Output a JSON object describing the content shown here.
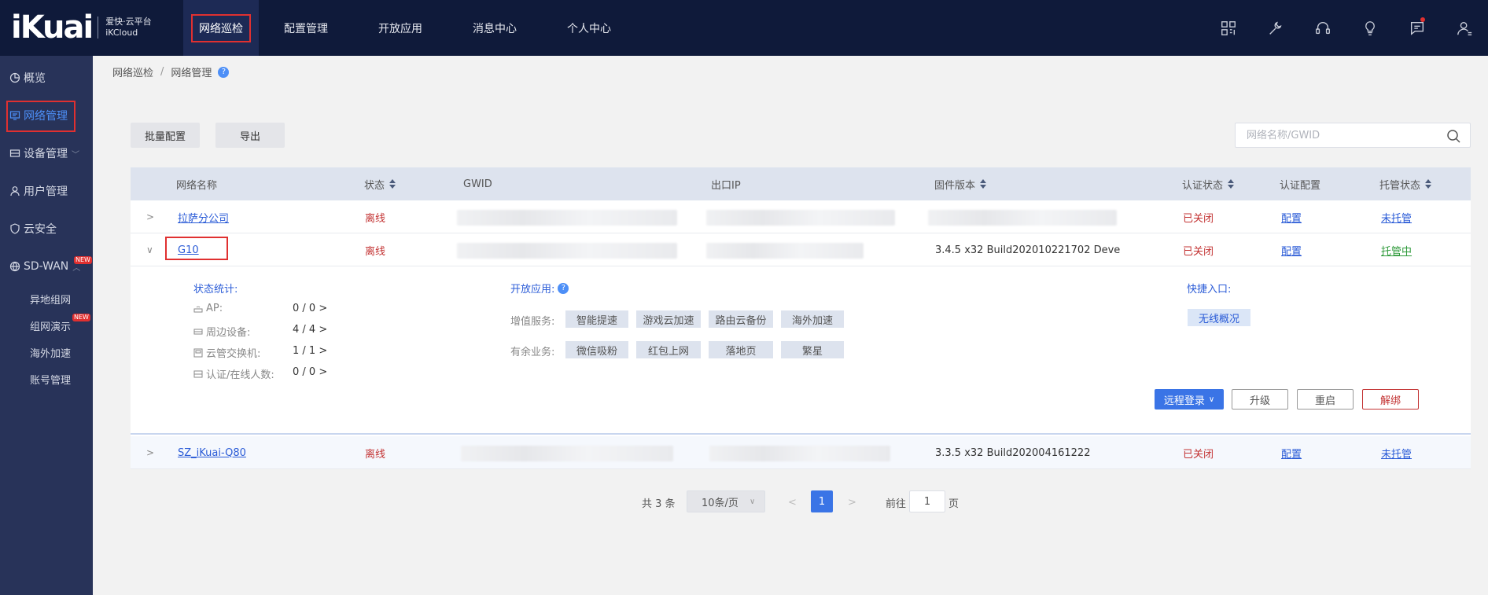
{
  "brand": {
    "name": "iKuai",
    "cn": "爱快·云平台",
    "en": "iKCloud"
  },
  "topnav": [
    "网络巡检",
    "配置管理",
    "开放应用",
    "消息中心",
    "个人中心"
  ],
  "top_icons": [
    "grid-icon",
    "tool-icon",
    "headset-icon",
    "bulb-icon",
    "message-icon",
    "user-icon"
  ],
  "sidebar": {
    "items": [
      "概览",
      "网络管理",
      "设备管理",
      "用户管理",
      "云安全",
      "SD-WAN"
    ],
    "sdwan_sub": [
      "异地组网",
      "组网演示",
      "海外加速",
      "账号管理"
    ],
    "new_badge": "NEW"
  },
  "breadcrumb": [
    "网络巡检",
    "网络管理"
  ],
  "toolbar": {
    "batch": "批量配置",
    "export": "导出"
  },
  "search": {
    "placeholder": "网络名称/GWID"
  },
  "table": {
    "headers": [
      "网络名称",
      "状态",
      "GWID",
      "出口IP",
      "固件版本",
      "认证状态",
      "认证配置",
      "托管状态"
    ],
    "rows": [
      {
        "name": "拉萨分公司",
        "status": "离线",
        "firmware": "",
        "auth": "已关闭",
        "config": "配置",
        "hosting": "未托管"
      },
      {
        "name": "G10",
        "status": "离线",
        "firmware": "3.4.5 x32 Build202010221702 Deve",
        "auth": "已关闭",
        "config": "配置",
        "hosting": "托管中"
      },
      {
        "name": "SZ_iKuai-Q80",
        "status": "离线",
        "firmware": "3.3.5 x32 Build202004161222",
        "auth": "已关闭",
        "config": "配置",
        "hosting": "未托管"
      }
    ]
  },
  "detail": {
    "status_title": "状态统计:",
    "stats": [
      {
        "label": "AP:",
        "value": "0 / 0  >"
      },
      {
        "label": "周边设备:",
        "value": "4 / 4  >"
      },
      {
        "label": "云管交换机:",
        "value": "1 / 1  >"
      },
      {
        "label": "认证/在线人数:",
        "value": "0 / 0  >"
      }
    ],
    "apps_title": "开放应用:",
    "value_service_label": "增值服务:",
    "value_services": [
      "智能提速",
      "游戏云加速",
      "路由云备份",
      "海外加速"
    ],
    "spare_label": "有余业务:",
    "spare_services": [
      "微信吸粉",
      "红包上网",
      "落地页",
      "繁星"
    ],
    "quick_title": "快捷入口:",
    "quick_links": [
      "无线概况"
    ],
    "actions": {
      "remote": "远程登录",
      "upgrade": "升级",
      "reboot": "重启",
      "unbind": "解绑"
    }
  },
  "pager": {
    "total": "共 3 条",
    "page_size": "10条/页",
    "current": "1",
    "goto": "前往",
    "goto_value": "1",
    "page_suffix": "页"
  }
}
